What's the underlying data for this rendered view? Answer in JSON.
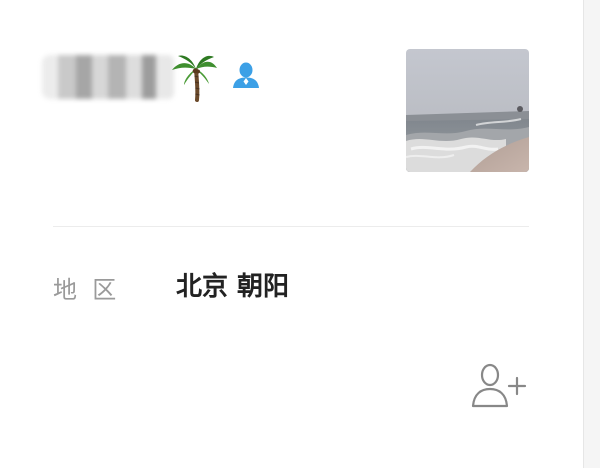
{
  "profile": {
    "region_label": "地  区",
    "region_value": "北京 朝阳"
  },
  "icons": {
    "nickname_emoji": "palm-tree",
    "contact_badge": "contact-person-icon",
    "add_friend": "add-friend-icon"
  },
  "colors": {
    "contact_badge": "#3ca0e6",
    "label_gray": "#9a9a9a",
    "value_dark": "#222222",
    "icon_gray": "#888888",
    "divider": "#ececec"
  }
}
